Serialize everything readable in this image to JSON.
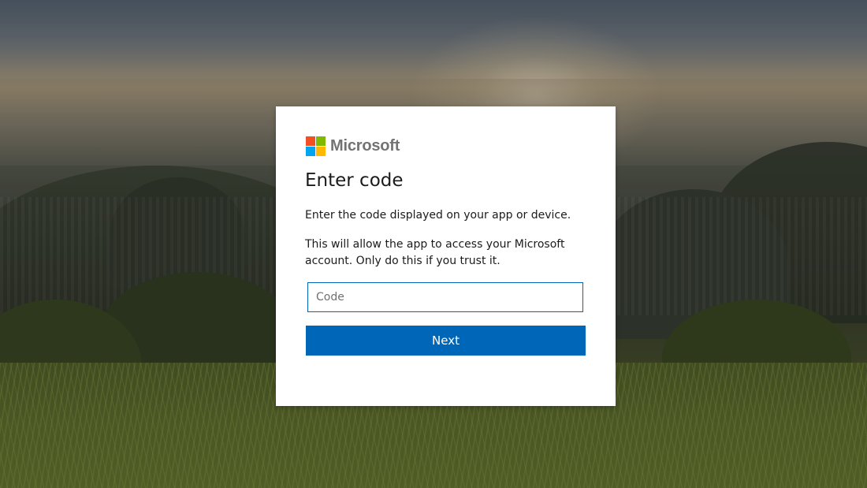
{
  "brand": {
    "name": "Microsoft",
    "logo_colors": [
      "#f25022",
      "#7fba00",
      "#00a4ef",
      "#ffb900"
    ]
  },
  "dialog": {
    "title": "Enter code",
    "instruction": "Enter the code displayed on your app or device.",
    "warning": "This will allow the app to access your Microsoft account. Only do this if you trust it.",
    "code_input": {
      "placeholder": "Code",
      "value": ""
    },
    "next_button_label": "Next"
  },
  "colors": {
    "accent": "#0067b8",
    "text": "#1b1b1b",
    "logo_text": "#737373"
  }
}
